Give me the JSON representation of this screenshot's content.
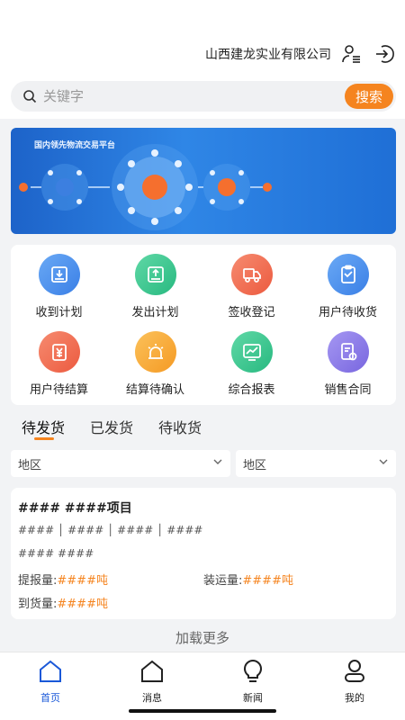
{
  "header": {
    "company_name": "山西建龙实业有限公司",
    "user_icon": "user-list-icon",
    "logout_icon": "logout-icon"
  },
  "search": {
    "placeholder": "关键字",
    "button_label": "搜索",
    "icon": "search-icon"
  },
  "banner": {
    "title": "国内领先物流交易平台"
  },
  "quick_actions": [
    {
      "label": "收到计划",
      "icon": "inbox-download-icon",
      "color": "#4a8ff0"
    },
    {
      "label": "发出计划",
      "icon": "inbox-upload-icon",
      "color": "#2fc48d"
    },
    {
      "label": "签收登记",
      "icon": "truck-icon",
      "color": "#f0694e"
    },
    {
      "label": "用户待收货",
      "icon": "clipboard-pending-icon",
      "color": "#4a8ff0"
    },
    {
      "label": "用户待结算",
      "icon": "yuan-hourglass-icon",
      "color": "#f0694e"
    },
    {
      "label": "结算待确认",
      "icon": "alarm-light-icon",
      "color": "#f7a531"
    },
    {
      "label": "综合报表",
      "icon": "chart-report-icon",
      "color": "#2fc48d"
    },
    {
      "label": "销售合同",
      "icon": "contract-icon",
      "color": "#8a7be8"
    }
  ],
  "tabs": [
    {
      "label": "待发货",
      "active": true
    },
    {
      "label": "已发货",
      "active": false
    },
    {
      "label": "待收货",
      "active": false
    }
  ],
  "filters": [
    {
      "value": "地区"
    },
    {
      "value": "地区"
    }
  ],
  "record": {
    "title": "#### ####项目",
    "line1": "#### │ #### │ #### │ ####",
    "line2": "#### ####",
    "report_label": "提报量:",
    "report_value": "####吨",
    "load_label": "装运量:",
    "load_value": "####吨",
    "arrive_label": "到货量:",
    "arrive_value": "####吨"
  },
  "load_more": "加载更多",
  "bottom_nav": [
    {
      "label": "首页",
      "icon": "home-icon",
      "active": true
    },
    {
      "label": "消息",
      "icon": "message-home-icon",
      "active": false
    },
    {
      "label": "新闻",
      "icon": "bulb-icon",
      "active": false
    },
    {
      "label": "我的",
      "icon": "profile-icon",
      "active": false
    }
  ],
  "colors": {
    "accent": "#f5841f",
    "nav_active": "#1a58d8"
  }
}
